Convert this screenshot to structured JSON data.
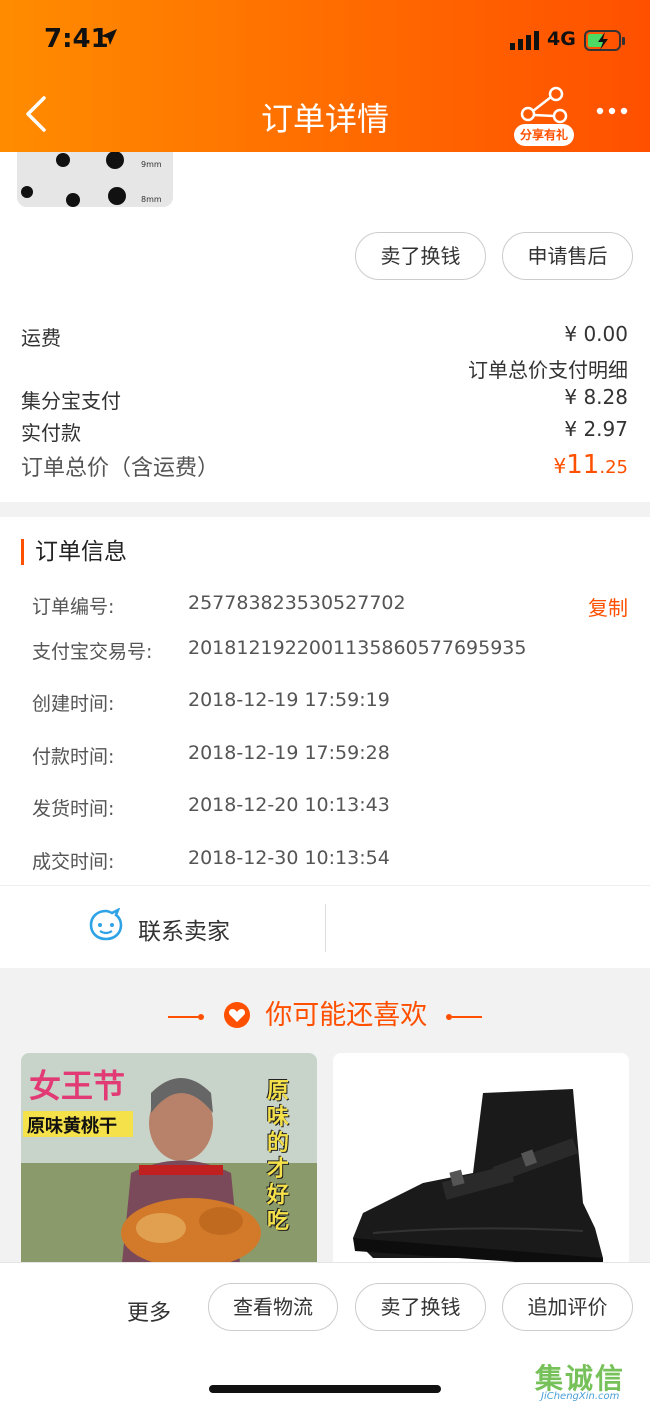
{
  "status_bar": {
    "time": "7:41",
    "network": "4G"
  },
  "nav": {
    "title": "订单详情",
    "share_label": "分享有礼"
  },
  "product": {
    "size_label_1": "9mm",
    "size_label_2": "8mm"
  },
  "actions_top": {
    "sell_btn": "卖了换钱",
    "after_sale_btn": "申请售后"
  },
  "payment": {
    "shipping_label": "运费",
    "shipping_value": "¥ 0.00",
    "detail_link": "订单总价支付明细",
    "points_label": "集分宝支付",
    "points_value": "¥ 8.28",
    "paid_label": "实付款",
    "paid_value": "¥ 2.97",
    "total_label": "订单总价（含运费）",
    "total_currency": "¥",
    "total_int": "11",
    "total_dec": ".25"
  },
  "order_info": {
    "title": "订单信息",
    "copy_label": "复制",
    "rows": [
      {
        "label": "订单编号:",
        "value": "257783823530527702"
      },
      {
        "label": "支付宝交易号:",
        "value": "2018121922001135860577695935"
      },
      {
        "label": "创建时间:",
        "value": "2018-12-19 17:59:19"
      },
      {
        "label": "付款时间:",
        "value": "2018-12-19 17:59:28"
      },
      {
        "label": "发货时间:",
        "value": "2018-12-20 10:13:43"
      },
      {
        "label": "成交时间:",
        "value": "2018-12-30 10:13:54"
      }
    ]
  },
  "contact": {
    "label": "联系卖家"
  },
  "recommend": {
    "title": "你可能还喜欢",
    "item1": {
      "tag_top": "女王节",
      "tag_banner": "原味黄桃干",
      "tag_side": "原味的才好吃"
    }
  },
  "bottom_bar": {
    "more": "更多",
    "logistics_btn": "查看物流",
    "sell_btn": "卖了换钱",
    "review_btn": "追加评价"
  },
  "watermark": {
    "cn": "集诚信",
    "en": "JiChengXin.com"
  },
  "colors": {
    "accent": "#ff5000",
    "header_start": "#ff8c00"
  }
}
